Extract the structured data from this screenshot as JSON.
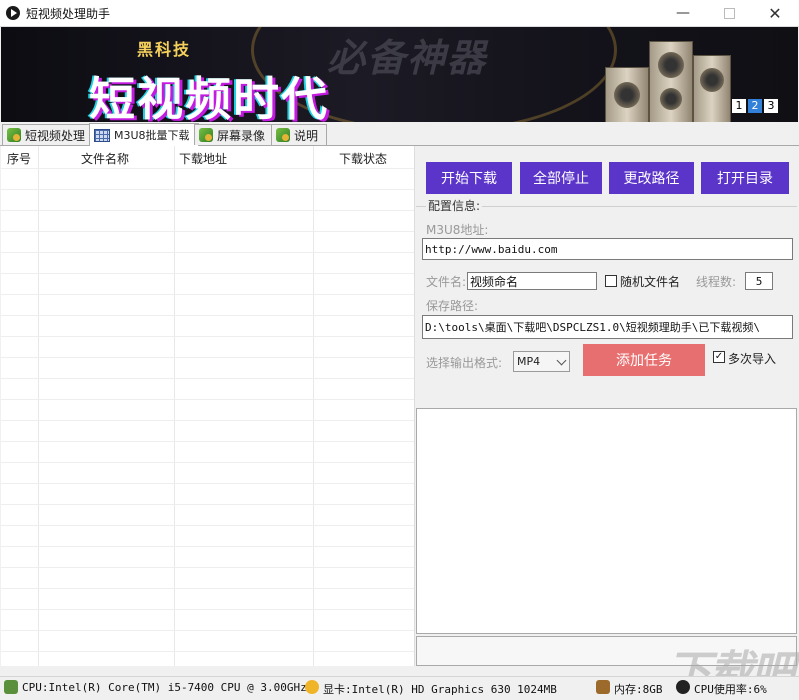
{
  "window": {
    "title": "短视频处理助手"
  },
  "banner": {
    "subtitle": "黑科技",
    "main_text": "短视频时代",
    "watermark": "必备神器",
    "pages": [
      "1",
      "2",
      "3"
    ],
    "active_page": "2"
  },
  "tabs": [
    {
      "label": "短视频处理"
    },
    {
      "label": "M3U8批量下载"
    },
    {
      "label": "屏幕录像"
    },
    {
      "label": "说明"
    }
  ],
  "table": {
    "columns": [
      "序号",
      "文件名称",
      "下载地址",
      "下载状态"
    ]
  },
  "actions": {
    "start": "开始下载",
    "stop_all": "全部停止",
    "change_path": "更改路径",
    "open_dir": "打开目录"
  },
  "config": {
    "legend": "配置信息:",
    "m3u8_label": "M3U8地址:",
    "m3u8_value": "http://www.baidu.com",
    "filename_label": "文件名:",
    "filename_value": "视频命名",
    "random_name_label": "随机文件名",
    "threads_label": "线程数:",
    "threads_value": "5",
    "save_path_label": "保存路径:",
    "save_path_value": "D:\\tools\\桌面\\下载吧\\DSPCLZS1.0\\短视频理助手\\已下载视频\\",
    "format_label": "选择输出格式:",
    "format_value": "MP4",
    "add_task": "添加任务",
    "multi_import_label": "多次导入",
    "multi_import_checked": true
  },
  "status": {
    "cpu": "CPU:Intel(R) Core(TM) i5-7400 CPU @ 3.00GHz",
    "gpu": "显卡:Intel(R) HD Graphics 630   1024MB",
    "memory": "内存:8GB",
    "cpu_usage": "CPU使用率:6%"
  },
  "site_watermark": "下载吧"
}
